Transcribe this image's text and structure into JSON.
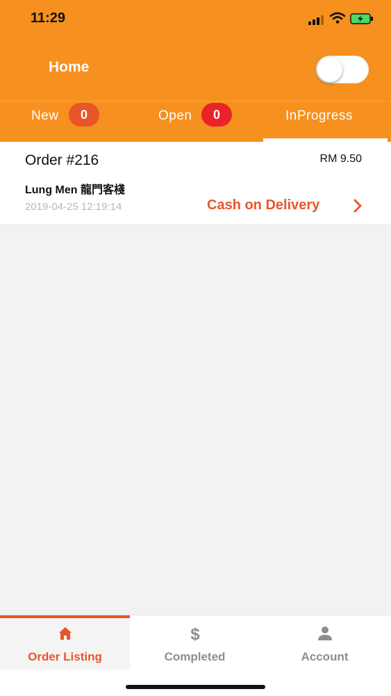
{
  "status_bar": {
    "time": "11:29",
    "icons": [
      "signal-icon",
      "wifi-icon",
      "battery-charging-icon"
    ]
  },
  "nav": {
    "title": "Home",
    "toggle_on": false
  },
  "tabs": [
    {
      "label": "New",
      "badge": "0",
      "badge_color": "#e8552a"
    },
    {
      "label": "Open",
      "badge": "0",
      "badge_color": "#e8232a"
    },
    {
      "label": "InProgress",
      "active": true
    }
  ],
  "orders": [
    {
      "number": "Order #216",
      "price": "RM 9.50",
      "restaurant": "Lung Men 龍門客棧",
      "date": "2019-04-25 12:19:14",
      "payment": "Cash on Delivery"
    }
  ],
  "bottom_nav": [
    {
      "label": "Order Listing",
      "icon": "home-icon",
      "active": true
    },
    {
      "label": "Completed",
      "icon": "dollar-icon"
    },
    {
      "label": "Account",
      "icon": "user-icon"
    }
  ],
  "colors": {
    "primary": "#f6901e",
    "accent": "#e8552a",
    "background": "#f2f2f2"
  }
}
